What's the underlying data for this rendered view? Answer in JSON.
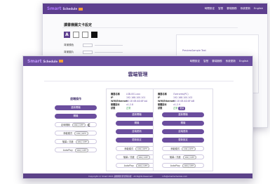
{
  "back_window": {
    "logo": "Smart",
    "logo_sub": "Schedule",
    "nav": [
      "時間設定",
      "智慧",
      "雲端服務",
      "系統更新",
      "English"
    ],
    "title": "讀書機圖文卡設定",
    "swatch_letter": "A",
    "row_labels": [
      "背景顏色",
      "背景圖片",
      "文字顏色",
      "文字大小"
    ],
    "panel_link": "PreviewSample Text"
  },
  "front_window": {
    "logo": "Smart",
    "logo_sub": "Schedule",
    "nav": [
      "時間設定",
      "智慧",
      "雲端服務",
      "系統更新",
      "English"
    ],
    "title": "雲端管理",
    "left_panel": {
      "heading": "遠端操作",
      "buttons": [
        "重新開機",
        "關機"
      ],
      "toggle_rows": [
        {
          "label": "定時開關",
          "pill": "ON | OFF"
        },
        {
          "label": "節能模式",
          "pill": "ON | OFF"
        },
        {
          "label": "螢幕 / 亮度",
          "pill": "ON | OFF"
        },
        {
          "label": "AutoPlay",
          "pill": "ON | OFF"
        }
      ]
    },
    "mid_panel": {
      "info": [
        {
          "k": "機器名稱",
          "v": "LSB-001-xxx"
        },
        {
          "k": "IP",
          "v": "192.168.100.101"
        },
        {
          "k": "Wifi/Ethernet",
          "v": "00:1E:0B:4D:8F:AA"
        },
        {
          "k": "韌體版本",
          "v": "v1.2.8"
        },
        {
          "k": "狀態",
          "v": "正常"
        }
      ],
      "buttons": [
        "重新開機",
        "關機",
        "遠端更新",
        "更新設定"
      ],
      "toggle_rows": [
        {
          "label": "節能模式",
          "pill": "ON | OFF"
        },
        {
          "label": "螢幕 / 亮度",
          "pill": "ON | OFF"
        },
        {
          "label": "AutoPlay",
          "pill": "ON | OFF"
        }
      ]
    },
    "right_panel": {
      "info": [
        {
          "k": "機器名稱",
          "v": "Overview(PC)"
        },
        {
          "k": "IP",
          "v": "192.168.100.102"
        },
        {
          "k": "Wifi/Ethernet",
          "v": "00:1E:0B:4D:8F:AB"
        },
        {
          "k": "韌體版本",
          "v": "v1.2.9"
        },
        {
          "k": "狀態",
          "v": "正常"
        }
      ],
      "status_pill": "更新",
      "buttons": [
        "重新開機",
        "關機",
        "遠端更新",
        "更新設定"
      ],
      "toggle_rows": [
        {
          "label": "節能模式",
          "pill": "ON | OFF"
        },
        {
          "label": "螢幕 / 亮度",
          "pill": "ON | OFF"
        },
        {
          "label": "AutoPlay",
          "pill": "ON | OFF"
        }
      ]
    },
    "footer_left": "Copyright (c) Smart 2021 讀書機智慧管理系統 · All Rights Reserved",
    "footer_right": "info@smartschedule.com"
  },
  "colors": {
    "brand_purple": "#6b4e9e",
    "header_dark": "#5d3f8e",
    "accent_orange": "#f2a03a"
  }
}
